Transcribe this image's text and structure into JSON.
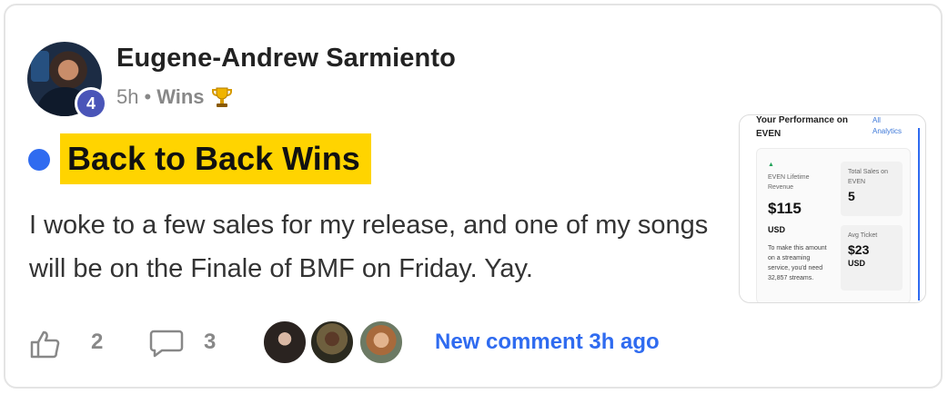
{
  "post": {
    "author_name": "Eugene-Andrew Sarmiento",
    "author_level": "4",
    "time_ago": "5h",
    "separator": "•",
    "category": "Wins",
    "category_icon": "trophy-icon",
    "title": "Back to Back Wins",
    "body": "I woke to a few sales for my release, and one of my songs will be on the Finale of BMF on Friday. Yay.",
    "unread_color": "#2f6bf0",
    "title_highlight_color": "#ffd400"
  },
  "attachment": {
    "heading": "Your Performance on EVEN",
    "link": "All Analytics",
    "lifetime_label": "EVEN Lifetime Revenue",
    "lifetime_value": "$115",
    "lifetime_currency": "USD",
    "note": "To make this amount on a streaming service, you'd need 32,857 streams.",
    "total_sales_label": "Total Sales on EVEN",
    "total_sales_value": "5",
    "avg_ticket_label": "Avg Ticket",
    "avg_ticket_value": "$23",
    "avg_ticket_currency": "USD"
  },
  "actions": {
    "like_icon": "thumbs-up-icon",
    "like_count": "2",
    "comment_icon": "comment-bubble-icon",
    "comment_count": "3",
    "commenter_avatars": 3,
    "new_comment_label": "New comment 3h ago",
    "link_color": "#2f6bf0"
  }
}
